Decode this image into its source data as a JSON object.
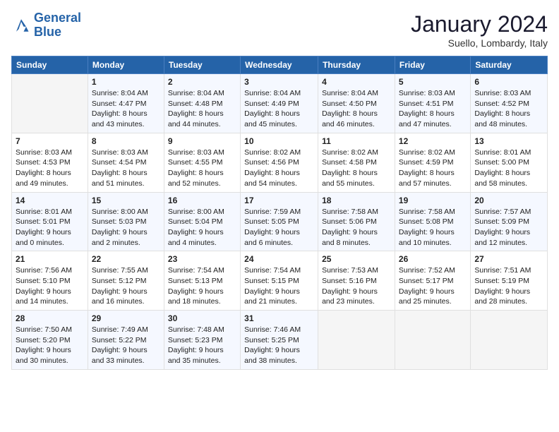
{
  "header": {
    "logo_line1": "General",
    "logo_line2": "Blue",
    "month": "January 2024",
    "location": "Suello, Lombardy, Italy"
  },
  "weekdays": [
    "Sunday",
    "Monday",
    "Tuesday",
    "Wednesday",
    "Thursday",
    "Friday",
    "Saturday"
  ],
  "weeks": [
    [
      {
        "day": "",
        "sunrise": "",
        "sunset": "",
        "daylight": ""
      },
      {
        "day": "1",
        "sunrise": "Sunrise: 8:04 AM",
        "sunset": "Sunset: 4:47 PM",
        "daylight": "Daylight: 8 hours and 43 minutes."
      },
      {
        "day": "2",
        "sunrise": "Sunrise: 8:04 AM",
        "sunset": "Sunset: 4:48 PM",
        "daylight": "Daylight: 8 hours and 44 minutes."
      },
      {
        "day": "3",
        "sunrise": "Sunrise: 8:04 AM",
        "sunset": "Sunset: 4:49 PM",
        "daylight": "Daylight: 8 hours and 45 minutes."
      },
      {
        "day": "4",
        "sunrise": "Sunrise: 8:04 AM",
        "sunset": "Sunset: 4:50 PM",
        "daylight": "Daylight: 8 hours and 46 minutes."
      },
      {
        "day": "5",
        "sunrise": "Sunrise: 8:03 AM",
        "sunset": "Sunset: 4:51 PM",
        "daylight": "Daylight: 8 hours and 47 minutes."
      },
      {
        "day": "6",
        "sunrise": "Sunrise: 8:03 AM",
        "sunset": "Sunset: 4:52 PM",
        "daylight": "Daylight: 8 hours and 48 minutes."
      }
    ],
    [
      {
        "day": "7",
        "sunrise": "Sunrise: 8:03 AM",
        "sunset": "Sunset: 4:53 PM",
        "daylight": "Daylight: 8 hours and 49 minutes."
      },
      {
        "day": "8",
        "sunrise": "Sunrise: 8:03 AM",
        "sunset": "Sunset: 4:54 PM",
        "daylight": "Daylight: 8 hours and 51 minutes."
      },
      {
        "day": "9",
        "sunrise": "Sunrise: 8:03 AM",
        "sunset": "Sunset: 4:55 PM",
        "daylight": "Daylight: 8 hours and 52 minutes."
      },
      {
        "day": "10",
        "sunrise": "Sunrise: 8:02 AM",
        "sunset": "Sunset: 4:56 PM",
        "daylight": "Daylight: 8 hours and 54 minutes."
      },
      {
        "day": "11",
        "sunrise": "Sunrise: 8:02 AM",
        "sunset": "Sunset: 4:58 PM",
        "daylight": "Daylight: 8 hours and 55 minutes."
      },
      {
        "day": "12",
        "sunrise": "Sunrise: 8:02 AM",
        "sunset": "Sunset: 4:59 PM",
        "daylight": "Daylight: 8 hours and 57 minutes."
      },
      {
        "day": "13",
        "sunrise": "Sunrise: 8:01 AM",
        "sunset": "Sunset: 5:00 PM",
        "daylight": "Daylight: 8 hours and 58 minutes."
      }
    ],
    [
      {
        "day": "14",
        "sunrise": "Sunrise: 8:01 AM",
        "sunset": "Sunset: 5:01 PM",
        "daylight": "Daylight: 9 hours and 0 minutes."
      },
      {
        "day": "15",
        "sunrise": "Sunrise: 8:00 AM",
        "sunset": "Sunset: 5:03 PM",
        "daylight": "Daylight: 9 hours and 2 minutes."
      },
      {
        "day": "16",
        "sunrise": "Sunrise: 8:00 AM",
        "sunset": "Sunset: 5:04 PM",
        "daylight": "Daylight: 9 hours and 4 minutes."
      },
      {
        "day": "17",
        "sunrise": "Sunrise: 7:59 AM",
        "sunset": "Sunset: 5:05 PM",
        "daylight": "Daylight: 9 hours and 6 minutes."
      },
      {
        "day": "18",
        "sunrise": "Sunrise: 7:58 AM",
        "sunset": "Sunset: 5:06 PM",
        "daylight": "Daylight: 9 hours and 8 minutes."
      },
      {
        "day": "19",
        "sunrise": "Sunrise: 7:58 AM",
        "sunset": "Sunset: 5:08 PM",
        "daylight": "Daylight: 9 hours and 10 minutes."
      },
      {
        "day": "20",
        "sunrise": "Sunrise: 7:57 AM",
        "sunset": "Sunset: 5:09 PM",
        "daylight": "Daylight: 9 hours and 12 minutes."
      }
    ],
    [
      {
        "day": "21",
        "sunrise": "Sunrise: 7:56 AM",
        "sunset": "Sunset: 5:10 PM",
        "daylight": "Daylight: 9 hours and 14 minutes."
      },
      {
        "day": "22",
        "sunrise": "Sunrise: 7:55 AM",
        "sunset": "Sunset: 5:12 PM",
        "daylight": "Daylight: 9 hours and 16 minutes."
      },
      {
        "day": "23",
        "sunrise": "Sunrise: 7:54 AM",
        "sunset": "Sunset: 5:13 PM",
        "daylight": "Daylight: 9 hours and 18 minutes."
      },
      {
        "day": "24",
        "sunrise": "Sunrise: 7:54 AM",
        "sunset": "Sunset: 5:15 PM",
        "daylight": "Daylight: 9 hours and 21 minutes."
      },
      {
        "day": "25",
        "sunrise": "Sunrise: 7:53 AM",
        "sunset": "Sunset: 5:16 PM",
        "daylight": "Daylight: 9 hours and 23 minutes."
      },
      {
        "day": "26",
        "sunrise": "Sunrise: 7:52 AM",
        "sunset": "Sunset: 5:17 PM",
        "daylight": "Daylight: 9 hours and 25 minutes."
      },
      {
        "day": "27",
        "sunrise": "Sunrise: 7:51 AM",
        "sunset": "Sunset: 5:19 PM",
        "daylight": "Daylight: 9 hours and 28 minutes."
      }
    ],
    [
      {
        "day": "28",
        "sunrise": "Sunrise: 7:50 AM",
        "sunset": "Sunset: 5:20 PM",
        "daylight": "Daylight: 9 hours and 30 minutes."
      },
      {
        "day": "29",
        "sunrise": "Sunrise: 7:49 AM",
        "sunset": "Sunset: 5:22 PM",
        "daylight": "Daylight: 9 hours and 33 minutes."
      },
      {
        "day": "30",
        "sunrise": "Sunrise: 7:48 AM",
        "sunset": "Sunset: 5:23 PM",
        "daylight": "Daylight: 9 hours and 35 minutes."
      },
      {
        "day": "31",
        "sunrise": "Sunrise: 7:46 AM",
        "sunset": "Sunset: 5:25 PM",
        "daylight": "Daylight: 9 hours and 38 minutes."
      },
      {
        "day": "",
        "sunrise": "",
        "sunset": "",
        "daylight": ""
      },
      {
        "day": "",
        "sunrise": "",
        "sunset": "",
        "daylight": ""
      },
      {
        "day": "",
        "sunrise": "",
        "sunset": "",
        "daylight": ""
      }
    ]
  ]
}
